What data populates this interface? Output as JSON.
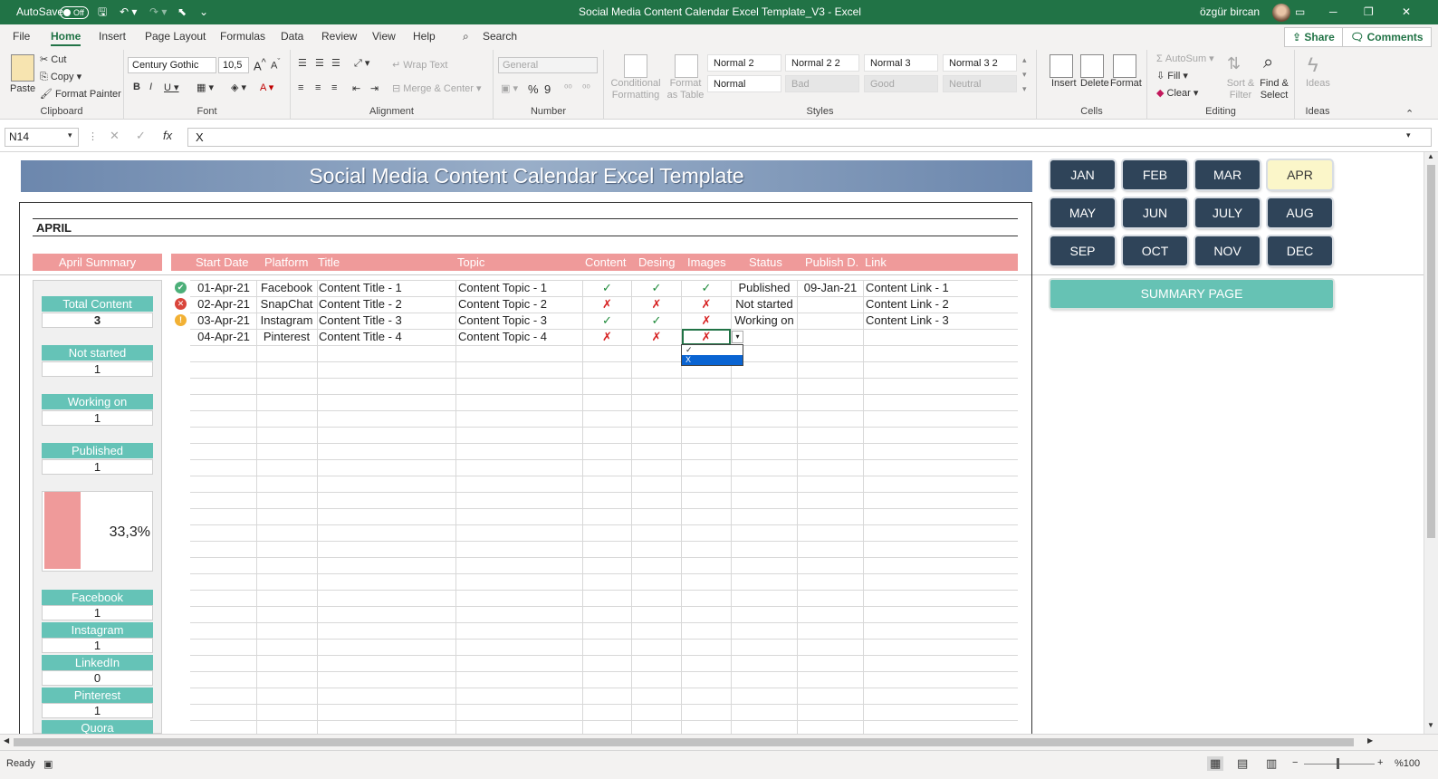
{
  "titlebar": {
    "autosave_label": "AutoSave",
    "autosave_state": "Off",
    "doc_title": "Social Media Content Calendar Excel Template_V3  -  Excel",
    "user_name": "özgür bircan"
  },
  "menu": {
    "tabs": [
      "File",
      "Home",
      "Insert",
      "Page Layout",
      "Formulas",
      "Data",
      "Review",
      "View",
      "Help"
    ],
    "search_label": "Search",
    "share_label": "Share",
    "comments_label": "Comments"
  },
  "ribbon": {
    "clipboard": {
      "paste": "Paste",
      "cut": "Cut",
      "copy": "Copy",
      "format_painter": "Format Painter",
      "label": "Clipboard"
    },
    "font": {
      "name": "Century Gothic",
      "size": "10,5",
      "label": "Font"
    },
    "alignment": {
      "wrap_text": "Wrap Text",
      "merge_center": "Merge & Center",
      "label": "Alignment"
    },
    "number": {
      "format": "General",
      "label": "Number"
    },
    "styles": {
      "conditional": "Conditional Formatting",
      "format_table": "Format as Table",
      "cells": [
        "Normal 2",
        "Normal 2 2",
        "Normal 3",
        "Normal 3 2",
        "Normal",
        "Bad",
        "Good",
        "Neutral"
      ],
      "label": "Styles"
    },
    "cells": {
      "insert": "Insert",
      "delete": "Delete",
      "format": "Format",
      "label": "Cells"
    },
    "editing": {
      "autosum": "AutoSum",
      "fill": "Fill",
      "clear": "Clear",
      "sort_filter": "Sort & Filter",
      "find_select": "Find & Select",
      "label": "Editing"
    },
    "ideas": {
      "ideas": "Ideas",
      "label": "Ideas"
    }
  },
  "formula_bar": {
    "name_box": "N14",
    "formula": "X"
  },
  "sheet": {
    "banner_title": "Social Media Content Calendar Excel Template",
    "month_title": "APRIL",
    "summary_header": "April Summary",
    "columns": [
      "Start Date",
      "Platform",
      "Title",
      "Topic",
      "Content",
      "Desing",
      "Images",
      "Status",
      "Publish D.",
      "Link"
    ],
    "rows": [
      {
        "start": "01-Apr-21",
        "platform": "Facebook",
        "title": "Content Title - 1",
        "topic": "Content Topic - 1",
        "content": "✓",
        "desing": "✓",
        "images": "✓",
        "status": "Published",
        "publish": "09-Jan-21",
        "link": "Content Link - 1",
        "icon": "✔",
        "icon_color": "#4caf79"
      },
      {
        "start": "02-Apr-21",
        "platform": "SnapChat",
        "title": "Content Title - 2",
        "topic": "Content Topic - 2",
        "content": "✗",
        "desing": "✗",
        "images": "✗",
        "status": "Not started",
        "publish": "",
        "link": "Content Link - 2",
        "icon": "✕",
        "icon_color": "#d9453b"
      },
      {
        "start": "03-Apr-21",
        "platform": "Instagram",
        "title": "Content Title - 3",
        "topic": "Content Topic - 3",
        "content": "✓",
        "desing": "✓",
        "images": "✗",
        "status": "Working on",
        "publish": "",
        "link": "Content Link - 3",
        "icon": "!",
        "icon_color": "#f2b134"
      },
      {
        "start": "04-Apr-21",
        "platform": "Pinterest",
        "title": "Content Title - 4",
        "topic": "Content Topic - 4",
        "content": "✗",
        "desing": "✗",
        "images": "✗",
        "status": "",
        "publish": "",
        "link": "",
        "icon": "",
        "icon_color": ""
      }
    ],
    "summary": {
      "total_label": "Total Content",
      "total_value": "3",
      "not_started_label": "Not started",
      "not_started_value": "1",
      "working_label": "Working on",
      "working_value": "1",
      "published_label": "Published",
      "published_value": "1",
      "percent_text": "33,3%",
      "percent_value": 0.333,
      "platforms": [
        {
          "label": "Facebook",
          "value": "1"
        },
        {
          "label": "Instagram",
          "value": "1"
        },
        {
          "label": "LinkedIn",
          "value": "0"
        },
        {
          "label": "Pinterest",
          "value": "1"
        },
        {
          "label": "Quora",
          "value": ""
        }
      ]
    },
    "dropdown": {
      "options": [
        "✓",
        "X"
      ],
      "selected": "X"
    },
    "months": [
      "JAN",
      "FEB",
      "MAR",
      "APR",
      "MAY",
      "JUN",
      "JULY",
      "AUG",
      "SEP",
      "OCT",
      "NOV",
      "DEC"
    ],
    "active_month": "APR",
    "summary_page_label": "SUMMARY PAGE"
  },
  "status": {
    "ready": "Ready",
    "zoom": "%100"
  },
  "colors": {
    "excel_green": "#217346",
    "header_pink": "#ef9a9a",
    "teal": "#65c3b7",
    "navy_button": "#2f4459",
    "active_month": "#fbf6c9"
  }
}
